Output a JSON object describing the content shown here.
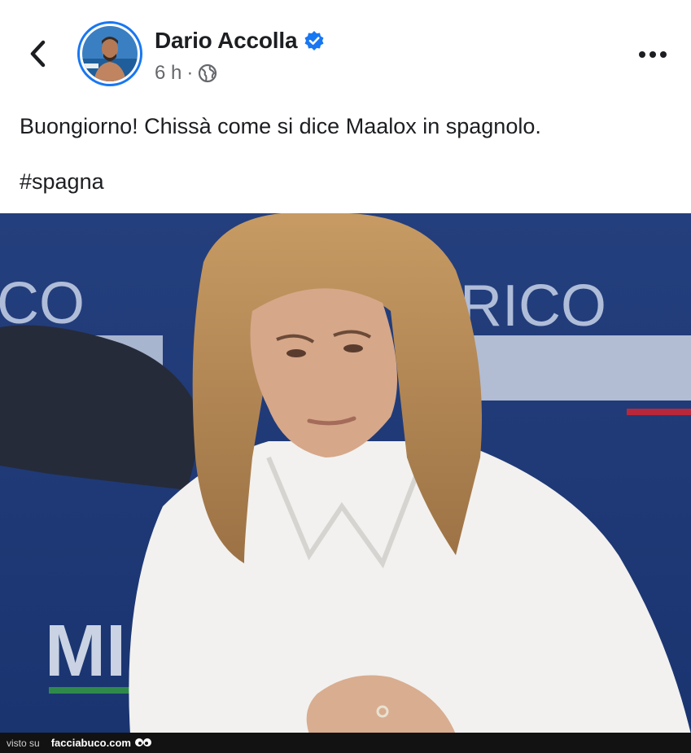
{
  "post": {
    "author_name": "Dario Accolla",
    "timestamp": "6 h",
    "separator": "·",
    "text": "Buongiorno! Chissà come si dice Maalox in spagnolo.",
    "hashtag": "#spagna"
  },
  "photo": {
    "backdrop_left_text": "CO",
    "backdrop_right_text": "RICO",
    "backdrop_lower_text": "MI"
  },
  "footer": {
    "prefix": "visto su",
    "site": "facciabuco.com"
  },
  "icons": {
    "back": "chevron-left-icon",
    "verified": "verified-badge-icon",
    "audience": "globe-icon",
    "more": "more-horizontal-icon"
  },
  "colors": {
    "verified_blue": "#1877f2",
    "text_primary": "#1c1e21",
    "text_secondary": "#65676b",
    "photo_background": "#1d3a7a"
  }
}
